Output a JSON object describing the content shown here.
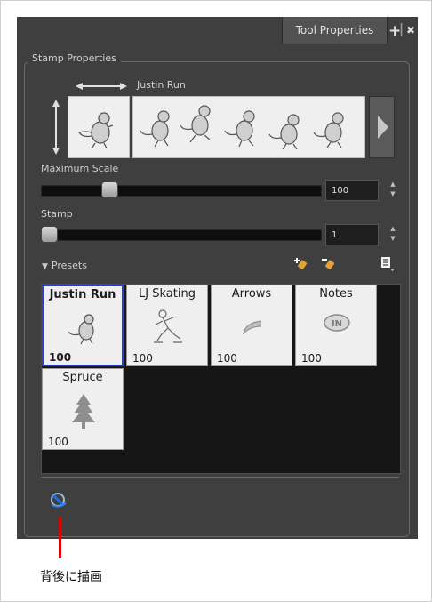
{
  "panel": {
    "tab_title": "Tool Properties",
    "add_glyph": "+",
    "close_glyph": "✖"
  },
  "stamp_properties": {
    "title": "Stamp Properties",
    "stamp_name": "Justin Run",
    "maximum_scale": {
      "label": "Maximum Scale",
      "value": "100",
      "level": 0.23
    },
    "stamp": {
      "label": "Stamp",
      "value": "1",
      "level": 0.0
    }
  },
  "presets": {
    "label": "Presets",
    "items": [
      {
        "name": "Justin Run",
        "size": "100",
        "icon": "beaver-icon",
        "selected": true
      },
      {
        "name": "LJ Skating",
        "size": "100",
        "icon": "skater-icon",
        "selected": false
      },
      {
        "name": "Arrows",
        "size": "100",
        "icon": "arrow-stroke-icon",
        "selected": false
      },
      {
        "name": "Notes",
        "size": "100",
        "icon": "note-stamp-icon",
        "selected": false
      },
      {
        "name": "Spruce",
        "size": "100",
        "icon": "tree-icon",
        "selected": false
      }
    ]
  },
  "footer": {
    "draw_behind_icon": "draw-behind-icon"
  },
  "callout": {
    "text": "背後に描画",
    "color": "#e00000"
  },
  "colors": {
    "panel": "#3f3f3f",
    "selection": "#2f39d6"
  }
}
